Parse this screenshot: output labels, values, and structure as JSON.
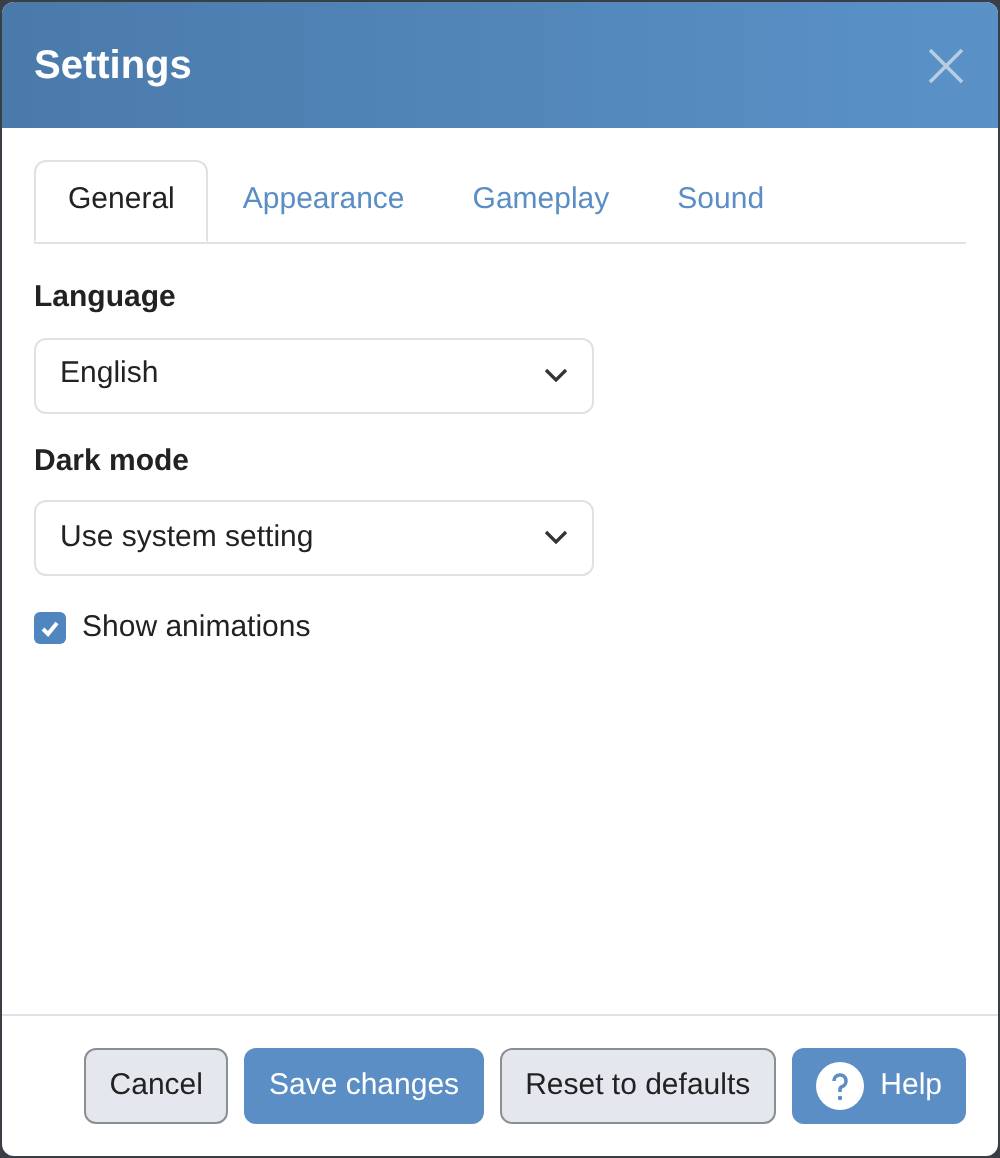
{
  "dialog": {
    "title": "Settings"
  },
  "tabs": [
    {
      "label": "General",
      "selected": true
    },
    {
      "label": "Appearance",
      "selected": false
    },
    {
      "label": "Gameplay",
      "selected": false
    },
    {
      "label": "Sound",
      "selected": false
    }
  ],
  "fields": [
    {
      "kind": "select",
      "label": "Language",
      "value": "English"
    },
    {
      "kind": "select",
      "label": "Dark mode",
      "value": "Use system setting"
    },
    {
      "kind": "checkbox",
      "label": "Show animations",
      "checked": true
    }
  ],
  "buttons": [
    {
      "label": "Cancel",
      "kind": "secondary"
    },
    {
      "label": "Save changes",
      "kind": "primary"
    },
    {
      "label": "Reset to defaults",
      "kind": "secondary"
    },
    {
      "label": "Help",
      "kind": "help"
    }
  ]
}
